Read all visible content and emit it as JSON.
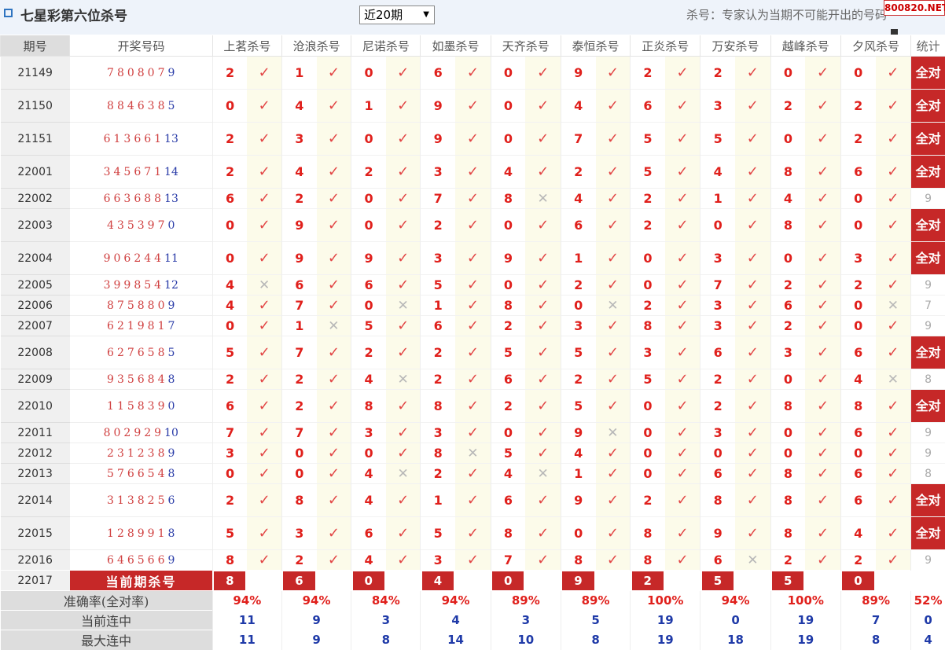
{
  "header": {
    "title": "七星彩第六位杀号",
    "select_value": "近20期",
    "note": "杀号：专家认为当期不可能开出的号码",
    "badge": "800820.NET"
  },
  "columns": {
    "period": "期号",
    "numbers": "开奖号码",
    "experts": [
      "上茗杀号",
      "沧浪杀号",
      "尼诺杀号",
      "如墨杀号",
      "天齐杀号",
      "泰恒杀号",
      "正炎杀号",
      "万安杀号",
      "越峰杀号",
      "夕风杀号"
    ],
    "stat": "统计"
  },
  "rows": [
    {
      "period": "21149",
      "digits": "780807",
      "last": "9",
      "kills": [
        "2",
        "1",
        "0",
        "6",
        "0",
        "9",
        "2",
        "2",
        "0",
        "0"
      ],
      "marks": [
        1,
        1,
        1,
        1,
        1,
        1,
        1,
        1,
        1,
        1
      ],
      "stat": "全对"
    },
    {
      "period": "21150",
      "digits": "884638",
      "last": "5",
      "kills": [
        "0",
        "4",
        "1",
        "9",
        "0",
        "4",
        "6",
        "3",
        "2",
        "2"
      ],
      "marks": [
        1,
        1,
        1,
        1,
        1,
        1,
        1,
        1,
        1,
        1
      ],
      "stat": "全对"
    },
    {
      "period": "21151",
      "digits": "613661",
      "last": "13",
      "kills": [
        "2",
        "3",
        "0",
        "9",
        "0",
        "7",
        "5",
        "5",
        "0",
        "2"
      ],
      "marks": [
        1,
        1,
        1,
        1,
        1,
        1,
        1,
        1,
        1,
        1
      ],
      "stat": "全对"
    },
    {
      "period": "22001",
      "digits": "345671",
      "last": "14",
      "kills": [
        "2",
        "4",
        "2",
        "3",
        "4",
        "2",
        "5",
        "4",
        "8",
        "6"
      ],
      "marks": [
        1,
        1,
        1,
        1,
        1,
        1,
        1,
        1,
        1,
        1
      ],
      "stat": "全对"
    },
    {
      "period": "22002",
      "digits": "663688",
      "last": "13",
      "kills": [
        "6",
        "2",
        "0",
        "7",
        "8",
        "4",
        "2",
        "1",
        "4",
        "0"
      ],
      "marks": [
        1,
        1,
        1,
        1,
        0,
        1,
        1,
        1,
        1,
        1
      ],
      "stat": "9"
    },
    {
      "period": "22003",
      "digits": "435397",
      "last": "0",
      "kills": [
        "0",
        "9",
        "0",
        "2",
        "0",
        "6",
        "2",
        "0",
        "8",
        "0"
      ],
      "marks": [
        1,
        1,
        1,
        1,
        1,
        1,
        1,
        1,
        1,
        1
      ],
      "stat": "全对"
    },
    {
      "period": "22004",
      "digits": "906244",
      "last": "11",
      "kills": [
        "0",
        "9",
        "9",
        "3",
        "9",
        "1",
        "0",
        "3",
        "0",
        "3"
      ],
      "marks": [
        1,
        1,
        1,
        1,
        1,
        1,
        1,
        1,
        1,
        1
      ],
      "stat": "全对"
    },
    {
      "period": "22005",
      "digits": "399854",
      "last": "12",
      "kills": [
        "4",
        "6",
        "6",
        "5",
        "0",
        "2",
        "0",
        "7",
        "2",
        "2"
      ],
      "marks": [
        0,
        1,
        1,
        1,
        1,
        1,
        1,
        1,
        1,
        1
      ],
      "stat": "9"
    },
    {
      "period": "22006",
      "digits": "875880",
      "last": "9",
      "kills": [
        "4",
        "7",
        "0",
        "1",
        "8",
        "0",
        "2",
        "3",
        "6",
        "0"
      ],
      "marks": [
        1,
        1,
        0,
        1,
        1,
        0,
        1,
        1,
        1,
        0
      ],
      "stat": "7"
    },
    {
      "period": "22007",
      "digits": "621981",
      "last": "7",
      "kills": [
        "0",
        "1",
        "5",
        "6",
        "2",
        "3",
        "8",
        "3",
        "2",
        "0"
      ],
      "marks": [
        1,
        0,
        1,
        1,
        1,
        1,
        1,
        1,
        1,
        1
      ],
      "stat": "9"
    },
    {
      "period": "22008",
      "digits": "627658",
      "last": "5",
      "kills": [
        "5",
        "7",
        "2",
        "2",
        "5",
        "5",
        "3",
        "6",
        "3",
        "6"
      ],
      "marks": [
        1,
        1,
        1,
        1,
        1,
        1,
        1,
        1,
        1,
        1
      ],
      "stat": "全对"
    },
    {
      "period": "22009",
      "digits": "935684",
      "last": "8",
      "kills": [
        "2",
        "2",
        "4",
        "2",
        "6",
        "2",
        "5",
        "2",
        "0",
        "4"
      ],
      "marks": [
        1,
        1,
        0,
        1,
        1,
        1,
        1,
        1,
        1,
        0
      ],
      "stat": "8"
    },
    {
      "period": "22010",
      "digits": "115839",
      "last": "0",
      "kills": [
        "6",
        "2",
        "8",
        "8",
        "2",
        "5",
        "0",
        "2",
        "8",
        "8"
      ],
      "marks": [
        1,
        1,
        1,
        1,
        1,
        1,
        1,
        1,
        1,
        1
      ],
      "stat": "全对"
    },
    {
      "period": "22011",
      "digits": "802929",
      "last": "10",
      "kills": [
        "7",
        "7",
        "3",
        "3",
        "0",
        "9",
        "0",
        "3",
        "0",
        "6"
      ],
      "marks": [
        1,
        1,
        1,
        1,
        1,
        0,
        1,
        1,
        1,
        1
      ],
      "stat": "9"
    },
    {
      "period": "22012",
      "digits": "231238",
      "last": "9",
      "kills": [
        "3",
        "0",
        "0",
        "8",
        "5",
        "4",
        "0",
        "0",
        "0",
        "0"
      ],
      "marks": [
        1,
        1,
        1,
        0,
        1,
        1,
        1,
        1,
        1,
        1
      ],
      "stat": "9"
    },
    {
      "period": "22013",
      "digits": "576654",
      "last": "8",
      "kills": [
        "0",
        "0",
        "4",
        "2",
        "4",
        "1",
        "0",
        "6",
        "8",
        "6"
      ],
      "marks": [
        1,
        1,
        0,
        1,
        0,
        1,
        1,
        1,
        1,
        1
      ],
      "stat": "8"
    },
    {
      "period": "22014",
      "digits": "313825",
      "last": "6",
      "kills": [
        "2",
        "8",
        "4",
        "1",
        "6",
        "9",
        "2",
        "8",
        "8",
        "6"
      ],
      "marks": [
        1,
        1,
        1,
        1,
        1,
        1,
        1,
        1,
        1,
        1
      ],
      "stat": "全对"
    },
    {
      "period": "22015",
      "digits": "128991",
      "last": "8",
      "kills": [
        "5",
        "3",
        "6",
        "5",
        "8",
        "0",
        "8",
        "9",
        "8",
        "4"
      ],
      "marks": [
        1,
        1,
        1,
        1,
        1,
        1,
        1,
        1,
        1,
        1
      ],
      "stat": "全对"
    },
    {
      "period": "22016",
      "digits": "646566",
      "last": "9",
      "kills": [
        "8",
        "2",
        "4",
        "3",
        "7",
        "8",
        "8",
        "6",
        "2",
        "2"
      ],
      "marks": [
        1,
        1,
        1,
        1,
        1,
        1,
        1,
        0,
        1,
        1
      ],
      "stat": "9"
    }
  ],
  "current": {
    "period": "22017",
    "label": "当前期杀号",
    "kills": [
      "8",
      "6",
      "0",
      "4",
      "0",
      "9",
      "2",
      "5",
      "5",
      "0"
    ]
  },
  "stats": {
    "accuracy": {
      "label": "准确率(全对率)",
      "values": [
        "94%",
        "94%",
        "84%",
        "94%",
        "89%",
        "89%",
        "100%",
        "94%",
        "100%",
        "89%"
      ],
      "total": "52%"
    },
    "streak": {
      "label": "当前连中",
      "values": [
        "11",
        "9",
        "3",
        "4",
        "3",
        "5",
        "19",
        "0",
        "19",
        "7"
      ],
      "total": "0"
    },
    "max_streak": {
      "label": "最大连中",
      "values": [
        "11",
        "9",
        "8",
        "14",
        "10",
        "8",
        "19",
        "18",
        "19",
        "8"
      ],
      "total": "4"
    }
  },
  "symbols": {
    "hit": "✓",
    "miss": "✕"
  },
  "colors": {
    "accent_red": "#c62828",
    "kill_red": "#e0201c",
    "blue": "#1f3aa8",
    "mark_bg": "#fcfbea"
  },
  "icons": {
    "title_marker": "square-outline-icon",
    "dropdown": "triangle-down-icon"
  }
}
